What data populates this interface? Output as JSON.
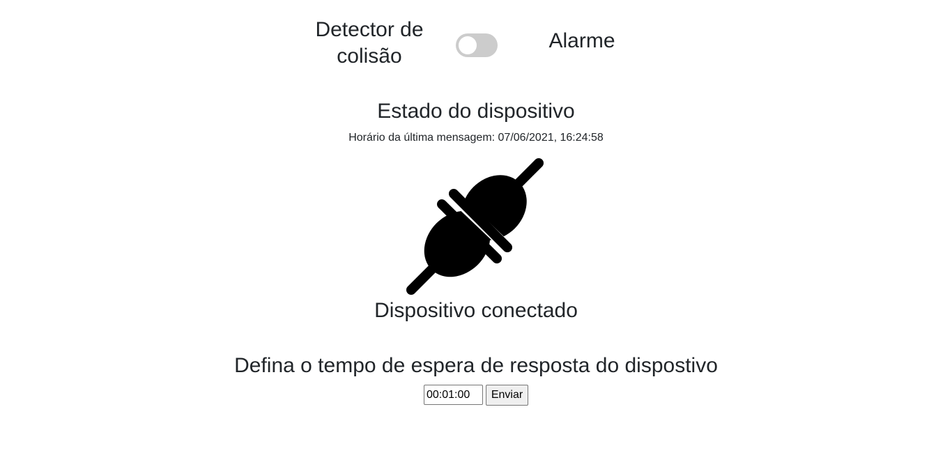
{
  "mode_switch": {
    "left_label": "Detector de colisão",
    "right_label": "Alarme",
    "checked": false
  },
  "status": {
    "title": "Estado do dispositivo",
    "last_message": "Horário da última mensagem: 07/06/2021, 16:24:58",
    "icon": "plug-icon",
    "state_label": "Dispositivo conectado"
  },
  "timeout": {
    "title": "Defina o tempo de espera de resposta do dispostivo",
    "value": "00:01:00",
    "submit_label": "Enviar"
  },
  "colors": {
    "toggle_off": "#cccccc",
    "text": "#212529",
    "icon": "#000000"
  }
}
